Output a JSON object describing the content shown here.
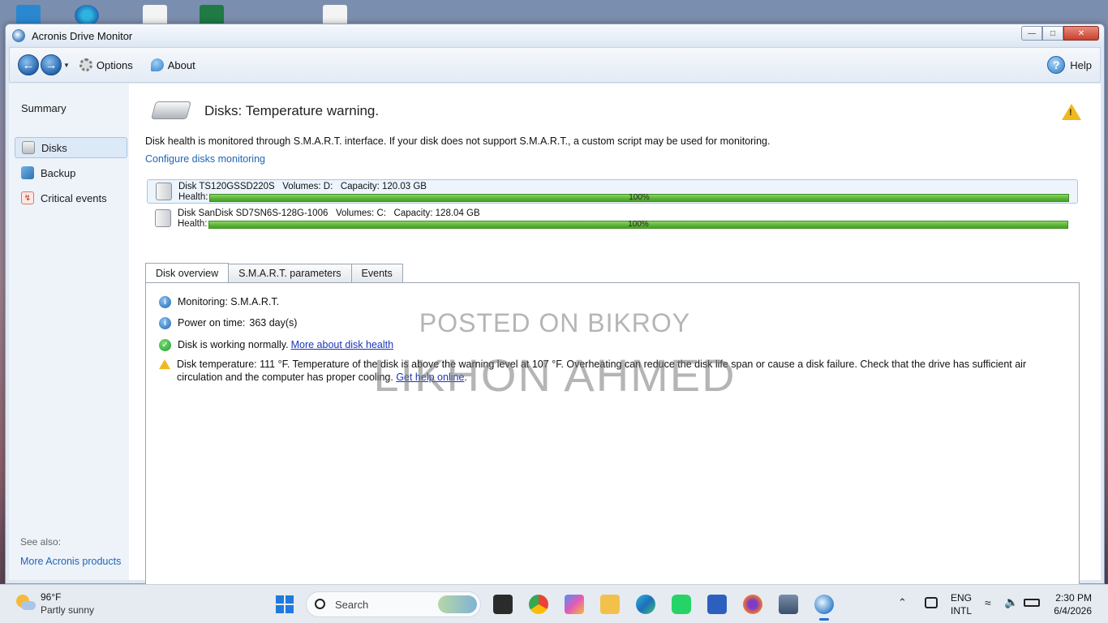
{
  "window": {
    "title": "Acronis Drive Monitor"
  },
  "toolbar": {
    "back_icon": "back-arrow-icon",
    "forward_icon": "forward-arrow-icon",
    "options_label": "Options",
    "about_label": "About",
    "help_label": "Help"
  },
  "sidebar": {
    "summary_label": "Summary",
    "items": [
      {
        "label": "Disks",
        "icon": "disk-icon",
        "selected": true
      },
      {
        "label": "Backup",
        "icon": "backup-icon",
        "selected": false
      },
      {
        "label": "Critical events",
        "icon": "critical-events-icon",
        "selected": false
      }
    ],
    "see_also_label": "See also:",
    "more_products_label": "More Acronis products"
  },
  "main": {
    "header_title": "Disks: Temperature warning.",
    "description": "Disk health is monitored through S.M.A.R.T. interface. If your disk does not support S.M.A.R.T., a custom script may be used for monitoring.",
    "configure_link": "Configure disks monitoring",
    "disks": [
      {
        "info": "Disk TS120GSSD220S   Volumes: D:   Capacity: 120.03 GB",
        "health_label": "Health:",
        "health_percent": "100%",
        "health_value": 1.0,
        "selected": true
      },
      {
        "info": "Disk SanDisk SD7SN6S-128G-1006   Volumes: C:   Capacity: 128.04 GB",
        "health_label": "Health:",
        "health_percent": "100%",
        "health_value": 1.0,
        "selected": false
      }
    ],
    "tabs": [
      {
        "label": "Disk overview",
        "active": true
      },
      {
        "label": "S.M.A.R.T. parameters",
        "active": false
      },
      {
        "label": "Events",
        "active": false
      }
    ],
    "overview": {
      "monitoring": "Monitoring: S.M.A.R.T.",
      "power_on_label": "Power on time:",
      "power_on_value": "363 day(s)",
      "status_text": "Disk is working normally.",
      "status_link": "More about disk health",
      "temperature_text": "Disk temperature: 111 °F. Temperature of the disk is above the warning level at 107 °F. Overheating can reduce the disk life span or cause a disk failure. Check that the drive has sufficient air circulation and the computer has proper cooling.",
      "temperature_link": "Get help online",
      "temperature_end": "."
    },
    "watermark_line1": "POSTED ON BIKROY",
    "watermark_line2": "LIKHON AHMED"
  },
  "taskbar": {
    "weather_temp": "96°F",
    "weather_desc": "Partly sunny",
    "search_placeholder": "Search",
    "lang_line1": "ENG",
    "lang_line2": "INTL",
    "time": "2:30 PM",
    "date": "6/4/2026"
  },
  "colors": {
    "link": "#1f66b6",
    "health_bar": "#58b332",
    "warning": "#f0b81f"
  }
}
